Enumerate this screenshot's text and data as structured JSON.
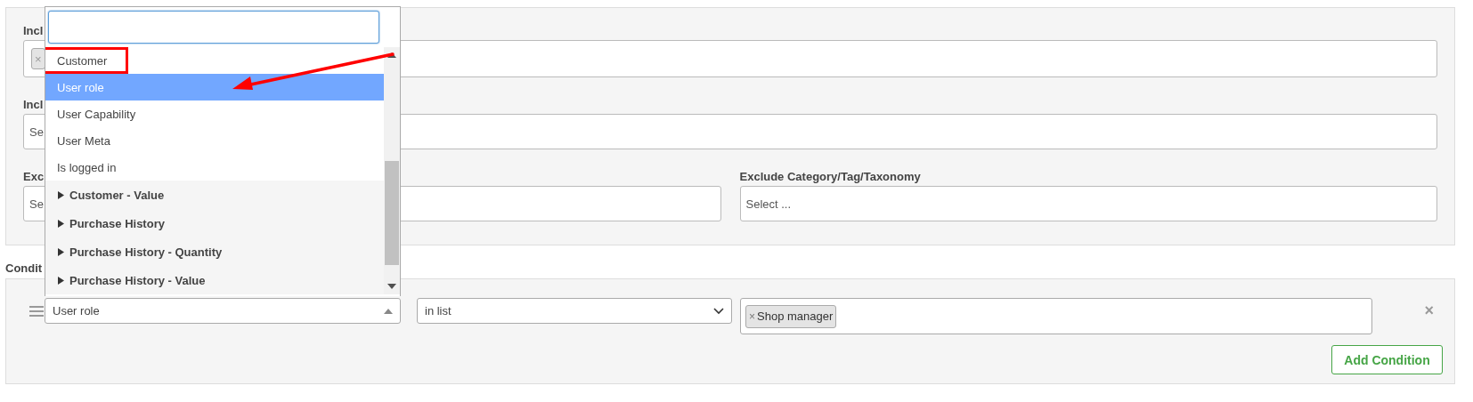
{
  "filters": {
    "fields": [
      {
        "label": "Incl",
        "kind": "tags",
        "tags": [
          {
            "remove": "×"
          }
        ]
      },
      {
        "label": "Incl",
        "kind": "select",
        "placeholder": "Se"
      }
    ],
    "exclude": [
      {
        "label": "Exc",
        "placeholder": "Se"
      },
      {
        "label": "Exclude Category/Tag/Taxonomy",
        "placeholder": "Select ..."
      }
    ]
  },
  "conditions": {
    "title": "Condit",
    "rows": [
      {
        "field": "User role",
        "open": true,
        "operator": "in list",
        "values": [
          {
            "remove": "×",
            "text": "Shop manager"
          }
        ],
        "remove_button": "×"
      }
    ],
    "add_button": "Add Condition"
  },
  "dropdown": {
    "options": [
      {
        "label": "Customer",
        "kind": "option",
        "selected": false,
        "highlighted": true
      },
      {
        "label": "User role",
        "kind": "option",
        "selected": true,
        "highlighted": false
      },
      {
        "label": "User Capability",
        "kind": "option",
        "selected": false,
        "highlighted": false
      },
      {
        "label": "User Meta",
        "kind": "option",
        "selected": false,
        "highlighted": false
      },
      {
        "label": "Is logged in",
        "kind": "option",
        "selected": false,
        "highlighted": false
      },
      {
        "label": "Customer - Value",
        "kind": "group",
        "expanded": false
      },
      {
        "label": "Purchase History",
        "kind": "group",
        "expanded": false
      },
      {
        "label": "Purchase History - Quantity",
        "kind": "group",
        "expanded": false
      },
      {
        "label": "Purchase History - Value",
        "kind": "group",
        "expanded": false
      }
    ]
  }
}
